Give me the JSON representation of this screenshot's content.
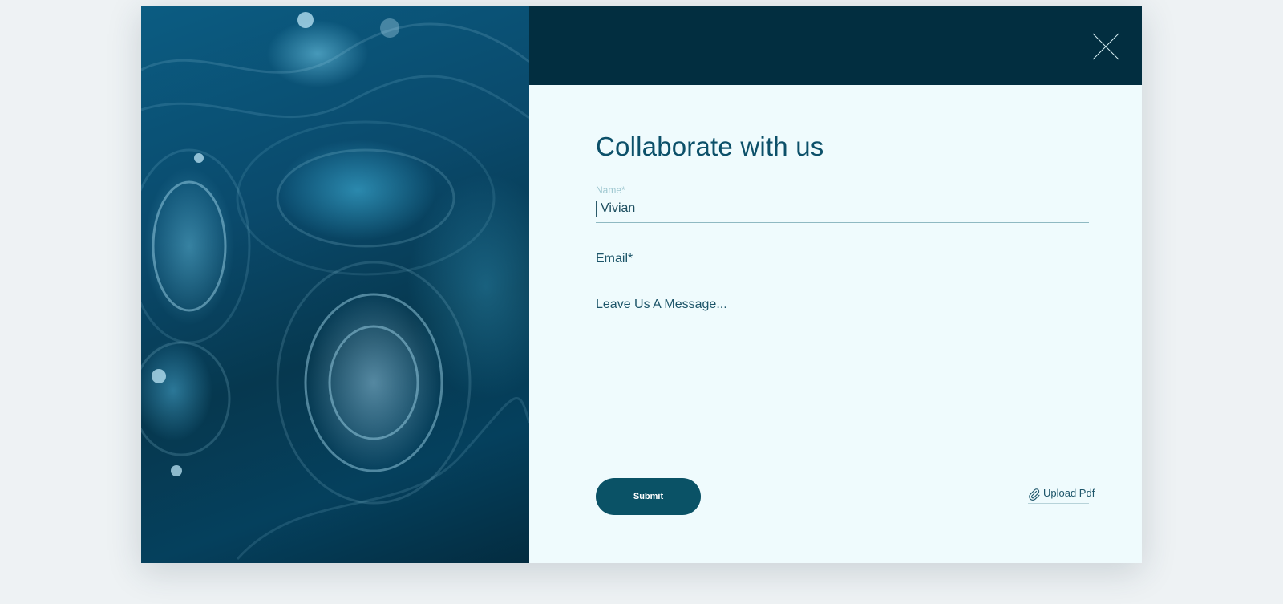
{
  "dialog": {
    "title": "Collaborate with us",
    "close_icon": "close-icon"
  },
  "form": {
    "name_label": "Name*",
    "name_value": "Vivian",
    "email_label": "Email*",
    "message_placeholder": "Leave Us A Message...",
    "submit_label": "Submit",
    "upload_label": "Upload Pdf",
    "upload_icon": "paperclip-icon"
  },
  "colors": {
    "accent": "#0a5266",
    "panel_background": "#effbfd",
    "header_background": "#022e40"
  }
}
